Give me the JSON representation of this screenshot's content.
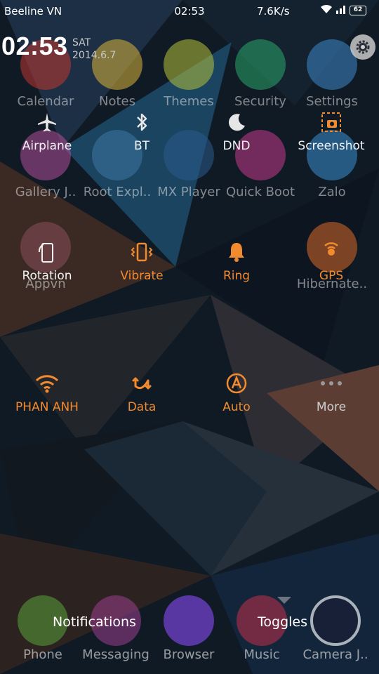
{
  "status_bar": {
    "carrier": "Beeline VN",
    "time": "02:53",
    "speed": "7.6K/s",
    "battery": "62"
  },
  "clock": {
    "time": "02:53",
    "day": "SAT",
    "date": "2014.6.7"
  },
  "apps": {
    "row1": [
      "Calendar",
      "Notes",
      "Themes",
      "Security",
      "Settings"
    ],
    "row2": [
      "Gallery J..",
      "Root Expl..",
      "MX Player",
      "Quick Boot",
      "Zalo"
    ],
    "row3": [
      "Appvn",
      "Hibernate.."
    ]
  },
  "toggles": [
    {
      "label": "Airplane",
      "icon": "airplane-icon"
    },
    {
      "label": "BT",
      "icon": "bluetooth-icon"
    },
    {
      "label": "DND",
      "icon": "moon-icon"
    },
    {
      "label": "Screenshot",
      "icon": "screenshot-icon"
    },
    {
      "label": "Rotation",
      "icon": "rotation-icon"
    },
    {
      "label": "Vibrate",
      "icon": "vibrate-icon"
    },
    {
      "label": "Ring",
      "icon": "bell-icon"
    },
    {
      "label": "GPS",
      "icon": "gps-icon"
    },
    {
      "label": "PHAN ANH",
      "icon": "wifi-icon"
    },
    {
      "label": "Data",
      "icon": "data-icon"
    },
    {
      "label": "Auto",
      "icon": "auto-brightness-icon"
    },
    {
      "label": "More",
      "icon": "more-icon"
    }
  ],
  "dock": [
    "Phone",
    "Messaging",
    "Browser",
    "Music",
    "Camera J.."
  ],
  "tabs": {
    "notifications": "Notifications",
    "toggles": "Toggles"
  },
  "colors": {
    "accent": "#f28a2e",
    "background": "#0f1a26"
  }
}
